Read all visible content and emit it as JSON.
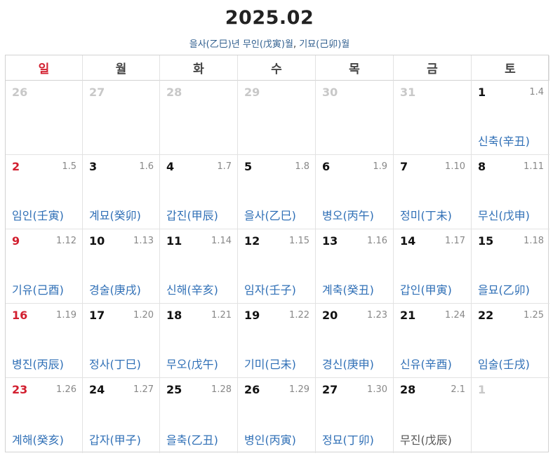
{
  "header": {
    "title": "2025.02",
    "year_ganzhi": "을사(乙巳)년",
    "month_ganzhi": "무인(戊寅)월",
    "separator": ",",
    "day_ganzhi": "기묘(己卯)월"
  },
  "weekdays": [
    "일",
    "월",
    "화",
    "수",
    "목",
    "금",
    "토"
  ],
  "colors": {
    "sunday": "#d21f2f",
    "ganzhi": "#2f6fb6",
    "other_month": "#c8c8c8",
    "lunar": "#888888"
  },
  "weeks": [
    [
      {
        "day": "26",
        "lunar": "",
        "ganzhi": "",
        "other": true
      },
      {
        "day": "27",
        "lunar": "",
        "ganzhi": "",
        "other": true
      },
      {
        "day": "28",
        "lunar": "",
        "ganzhi": "",
        "other": true
      },
      {
        "day": "29",
        "lunar": "",
        "ganzhi": "",
        "other": true
      },
      {
        "day": "30",
        "lunar": "",
        "ganzhi": "",
        "other": true
      },
      {
        "day": "31",
        "lunar": "",
        "ganzhi": "",
        "other": true
      },
      {
        "day": "1",
        "lunar": "1.4",
        "ganzhi": "신축(辛丑)"
      }
    ],
    [
      {
        "day": "2",
        "lunar": "1.5",
        "ganzhi": "임인(壬寅)"
      },
      {
        "day": "3",
        "lunar": "1.6",
        "ganzhi": "계묘(癸卯)"
      },
      {
        "day": "4",
        "lunar": "1.7",
        "ganzhi": "갑진(甲辰)"
      },
      {
        "day": "5",
        "lunar": "1.8",
        "ganzhi": "을사(乙巳)"
      },
      {
        "day": "6",
        "lunar": "1.9",
        "ganzhi": "병오(丙午)"
      },
      {
        "day": "7",
        "lunar": "1.10",
        "ganzhi": "정미(丁未)"
      },
      {
        "day": "8",
        "lunar": "1.11",
        "ganzhi": "무신(戊申)"
      }
    ],
    [
      {
        "day": "9",
        "lunar": "1.12",
        "ganzhi": "기유(己酉)"
      },
      {
        "day": "10",
        "lunar": "1.13",
        "ganzhi": "경술(庚戌)"
      },
      {
        "day": "11",
        "lunar": "1.14",
        "ganzhi": "신해(辛亥)"
      },
      {
        "day": "12",
        "lunar": "1.15",
        "ganzhi": "임자(壬子)"
      },
      {
        "day": "13",
        "lunar": "1.16",
        "ganzhi": "계축(癸丑)"
      },
      {
        "day": "14",
        "lunar": "1.17",
        "ganzhi": "갑인(甲寅)"
      },
      {
        "day": "15",
        "lunar": "1.18",
        "ganzhi": "을묘(乙卯)"
      }
    ],
    [
      {
        "day": "16",
        "lunar": "1.19",
        "ganzhi": "병진(丙辰)"
      },
      {
        "day": "17",
        "lunar": "1.20",
        "ganzhi": "정사(丁巳)"
      },
      {
        "day": "18",
        "lunar": "1.21",
        "ganzhi": "무오(戊午)"
      },
      {
        "day": "19",
        "lunar": "1.22",
        "ganzhi": "기미(己未)"
      },
      {
        "day": "20",
        "lunar": "1.23",
        "ganzhi": "경신(庚申)"
      },
      {
        "day": "21",
        "lunar": "1.24",
        "ganzhi": "신유(辛酉)"
      },
      {
        "day": "22",
        "lunar": "1.25",
        "ganzhi": "임술(壬戌)"
      }
    ],
    [
      {
        "day": "23",
        "lunar": "1.26",
        "ganzhi": "계해(癸亥)"
      },
      {
        "day": "24",
        "lunar": "1.27",
        "ganzhi": "갑자(甲子)"
      },
      {
        "day": "25",
        "lunar": "1.28",
        "ganzhi": "을축(乙丑)"
      },
      {
        "day": "26",
        "lunar": "1.29",
        "ganzhi": "병인(丙寅)"
      },
      {
        "day": "27",
        "lunar": "1.30",
        "ganzhi": "정묘(丁卯)"
      },
      {
        "day": "28",
        "lunar": "2.1",
        "ganzhi": "무진(戊辰)",
        "dark": true
      },
      {
        "day": "1",
        "lunar": "",
        "ganzhi": "",
        "other": true
      }
    ]
  ]
}
